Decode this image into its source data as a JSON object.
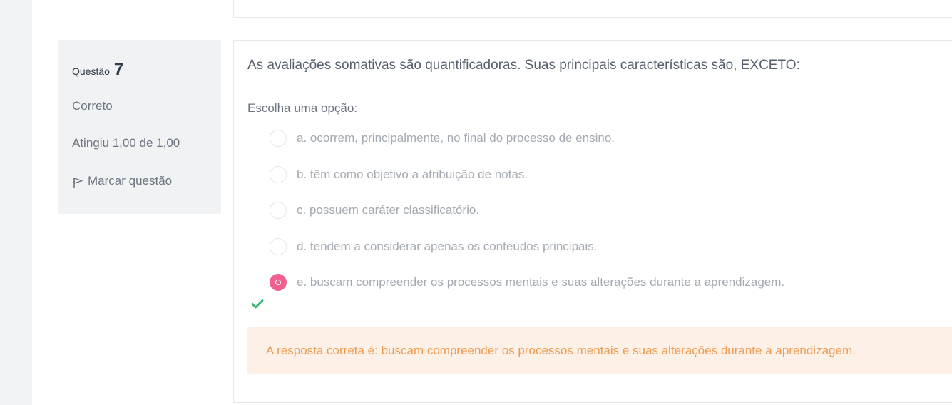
{
  "question": {
    "label": "Questão",
    "number": "7",
    "state": "Correto",
    "grade": "Atingiu 1,00 de 1,00",
    "flag_label": "Marcar questão",
    "text": "As avaliações somativas são quantificadoras. Suas principais características são, EXCETO:",
    "prompt": "Escolha uma opção:",
    "options": [
      {
        "label": "a. ocorrem, principalmente, no final do processo de ensino.",
        "selected": false
      },
      {
        "label": "b. têm como objetivo a atribuição de notas.",
        "selected": false
      },
      {
        "label": "c. possuem caráter classificatório.",
        "selected": false
      },
      {
        "label": "d. tendem a considerar apenas os conteúdos principais.",
        "selected": false
      },
      {
        "label": "e. buscam compreender os processos mentais e suas alterações durante a aprendizagem.",
        "selected": true
      }
    ],
    "feedback": "A resposta correta é: buscam compreender os processos mentais e suas alterações durante a aprendizagem."
  },
  "colors": {
    "selected_radio": "#f0618f",
    "correct_check": "#3fb67b",
    "feedback_bg": "#fdf1e7",
    "feedback_text": "#ee9a50"
  }
}
